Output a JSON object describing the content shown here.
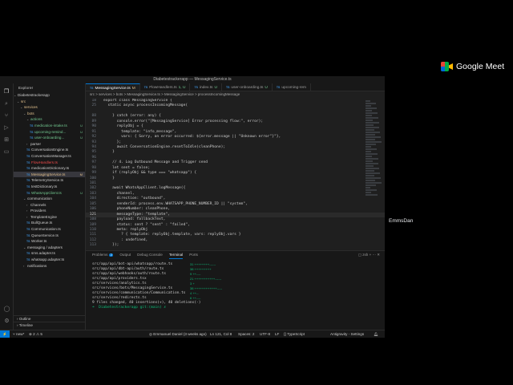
{
  "meet": {
    "brand": "Google Meet",
    "participant_name": "EmmsDan"
  },
  "window": {
    "title": "Diabetestrackerapp — MessagingService.ts"
  },
  "explorer": {
    "title": "Explorer",
    "root": "Diabetestrackerapp",
    "items": [
      {
        "label": "src",
        "kind": "folder",
        "indent": 1,
        "open": true,
        "color": "mod"
      },
      {
        "label": "services",
        "kind": "folder",
        "indent": 2,
        "open": true,
        "color": "mod"
      },
      {
        "label": "bots",
        "kind": "folder",
        "indent": 3,
        "open": true,
        "color": "mod"
      },
      {
        "label": "actions",
        "kind": "folder",
        "indent": 4,
        "open": true,
        "color": "untr"
      },
      {
        "label": "medication-intake.ts",
        "kind": "file",
        "indent": 5,
        "badge": "U",
        "color": "untr"
      },
      {
        "label": "upcoming-remind...",
        "kind": "file",
        "indent": 5,
        "badge": "U",
        "color": "untr"
      },
      {
        "label": "user-onboarding...",
        "kind": "file",
        "indent": 5,
        "badge": "U",
        "color": "untr"
      },
      {
        "label": "parser",
        "kind": "folder",
        "indent": 4,
        "open": false,
        "color": "none"
      },
      {
        "label": "ConversationEngine.ts",
        "kind": "file",
        "indent": 4,
        "color": "none"
      },
      {
        "label": "ConversationManager.ts",
        "kind": "file",
        "indent": 4,
        "color": "none"
      },
      {
        "label": "FlowHandlers.ts",
        "kind": "file",
        "indent": 4,
        "color": "err"
      },
      {
        "label": "medicationDictionary.ts",
        "kind": "file",
        "indent": 4,
        "color": "none"
      },
      {
        "label": "MessagingService.ts",
        "kind": "file",
        "indent": 4,
        "badge": "M",
        "color": "mod",
        "selected": true
      },
      {
        "label": "TelemetryService.ts",
        "kind": "file",
        "indent": 4,
        "color": "none"
      },
      {
        "label": "testDictionary.ts",
        "kind": "file",
        "indent": 4,
        "color": "none"
      },
      {
        "label": "WhatsAppClient.ts",
        "kind": "file",
        "indent": 4,
        "badge": "U",
        "color": "untr"
      },
      {
        "label": "communication",
        "kind": "folder",
        "indent": 3,
        "open": true,
        "color": "none"
      },
      {
        "label": "Channels",
        "kind": "folder",
        "indent": 4,
        "open": false,
        "color": "none"
      },
      {
        "label": "Providers",
        "kind": "folder",
        "indent": 4,
        "open": false,
        "color": "none"
      },
      {
        "label": "TemplateEngine",
        "kind": "folder",
        "indent": 4,
        "open": false,
        "color": "none"
      },
      {
        "label": "BullQueue.ts",
        "kind": "file",
        "indent": 4,
        "color": "none"
      },
      {
        "label": "Communication.ts",
        "kind": "file",
        "indent": 4,
        "color": "none"
      },
      {
        "label": "QueueService.ts",
        "kind": "file",
        "indent": 4,
        "color": "none"
      },
      {
        "label": "Worker.ts",
        "kind": "file",
        "indent": 4,
        "color": "none"
      },
      {
        "label": "messaging / adapters",
        "kind": "folder",
        "indent": 3,
        "open": true,
        "color": "none"
      },
      {
        "label": "sms.adapter.ts",
        "kind": "file",
        "indent": 4,
        "color": "none"
      },
      {
        "label": "whatsapp.adapter.ts",
        "kind": "file",
        "indent": 4,
        "color": "none"
      },
      {
        "label": "notifications",
        "kind": "folder",
        "indent": 3,
        "open": false,
        "color": "none"
      }
    ],
    "outline": "Outline",
    "timeline": "Timeline"
  },
  "tabs": [
    {
      "label": "MessagingService.ts",
      "badge": "M",
      "active": true
    },
    {
      "label": "FlowHandlers.ts",
      "badge": "1, U"
    },
    {
      "label": "index.ts",
      "badge": "U"
    },
    {
      "label": "user-onboarding.ts",
      "badge": "U"
    },
    {
      "label": "upcoming-rem",
      "badge": ""
    }
  ],
  "breadcrumb": "src > services > bots > MessagingService.ts > MessagingService > processIncomingMessage",
  "editor": {
    "lines": [
      {
        "n": "18",
        "text": "export class MessagingService {"
      },
      {
        "n": "25",
        "text": "  static async processIncomingMessage("
      },
      {
        "n": "",
        "text": ""
      },
      {
        "n": "88",
        "text": "    } catch (error: any) {"
      },
      {
        "n": "89",
        "text": "      console.error(\"[MessagingService] Error processing flow:\", error);"
      },
      {
        "n": "90",
        "text": "      replyObj = {"
      },
      {
        "n": "91",
        "text": "        template: \"info_message\","
      },
      {
        "n": "92",
        "text": "        vars: { Sorry, an error occurred: ${error.message || \"Unknown error\"}\"},"
      },
      {
        "n": "93",
        "text": "      };"
      },
      {
        "n": "94",
        "text": "      await ConversationEngine.resetToIdle(cleanPhone);"
      },
      {
        "n": "95",
        "text": "    }"
      },
      {
        "n": "96",
        "text": ""
      },
      {
        "n": "97",
        "text": "    // 4. Log Outbound Message and Trigger send"
      },
      {
        "n": "98",
        "text": "    let sent = false;"
      },
      {
        "n": "99",
        "text": "    if (replyObj && type === \"whatsapp\") {"
      },
      {
        "n": "100",
        "text": "    }"
      },
      {
        "n": "101",
        "text": ""
      },
      {
        "n": "102",
        "text": "    await WhatsAppClient.logMessage({"
      },
      {
        "n": "103",
        "text": "      channel,"
      },
      {
        "n": "104",
        "text": "      direction: \"outbound\","
      },
      {
        "n": "105",
        "text": "      senderId: process.env.WHATSAPP_PHONE_NUMBER_ID || \"system\","
      },
      {
        "n": "106",
        "text": "      phoneNumber: cleanPhone,"
      },
      {
        "n": "121",
        "text": "      messageType: \"template\",",
        "current": true
      },
      {
        "n": "108",
        "text": "      payload: fallbackText,"
      },
      {
        "n": "109",
        "text": "      status: sent ? \"sent\" : \"failed\","
      },
      {
        "n": "110",
        "text": "      meta: replyObj"
      },
      {
        "n": "111",
        "text": "        ? { template: replyObj.template, vars: replyObj.vars }"
      },
      {
        "n": "112",
        "text": "        : undefined,"
      },
      {
        "n": "113",
        "text": "    });"
      }
    ]
  },
  "panel": {
    "tabs": [
      "Problems",
      "Output",
      "Debug Console",
      "Terminal",
      "Ports"
    ],
    "problems_count": "2",
    "active_tab": "Terminal",
    "shell": "zsh",
    "terminal_lines": [
      "src/app/api/bot-api/whatsapp/route.ts",
      "src/app/api/dbt-api/auth/route.ts",
      "src/app/api/webhooks/auth/route.ts",
      "src/app/api/providers.tsx",
      "src/services/analytics.ts",
      "src/services/bots/MessagingService.ts",
      "src/services/communication/Communication.ts",
      "src/services/redirects.ts",
      "9 files changed, 40 insertions(+), 40 deletions(-)",
      "➜  Diabetestrackerapp git:(main) ✗"
    ],
    "terminal_stats": [
      "31 ++++++++------",
      "38 +++++++++",
      "9 ++----",
      "21 +++++++++++------",
      "3 +",
      "38 ++++++++++++-----",
      "4 ++--",
      "6 ++----"
    ]
  },
  "statusbar": {
    "branch": "new*",
    "errors": "2",
    "warnings": "5",
    "blame": "Emmanuel Daniel (3 weeks ago)",
    "position": "Ln 121, Col 8",
    "spaces": "Spaces: 2",
    "encoding": "UTF-8",
    "eol": "LF",
    "language": "TypeScript",
    "extension": "Antigravity - Settings"
  }
}
